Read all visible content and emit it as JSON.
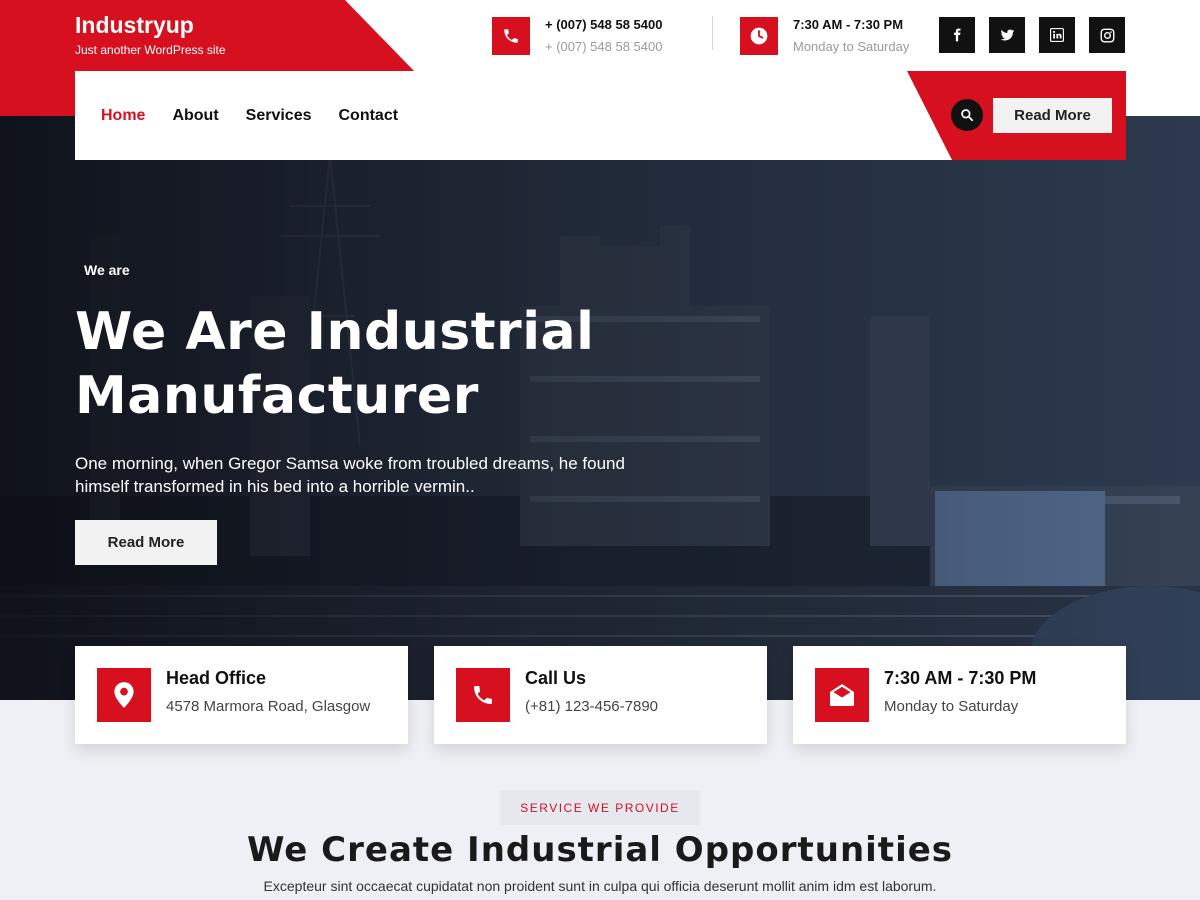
{
  "brand": {
    "name": "Industryup",
    "tagline": "Just another WordPress site"
  },
  "top_contact": {
    "phone": {
      "main": "+ (007) 548 58 5400",
      "sub": "+ (007) 548 58 5400",
      "icon": "phone-icon"
    },
    "hours": {
      "main": "7:30 AM - 7:30 PM",
      "sub": "Monday to Saturday",
      "icon": "clock-icon"
    }
  },
  "socials": [
    {
      "name": "facebook",
      "glyph": "f"
    },
    {
      "name": "twitter",
      "glyph": "t"
    },
    {
      "name": "linkedin",
      "glyph": "in"
    },
    {
      "name": "instagram",
      "glyph": "ig"
    }
  ],
  "nav": {
    "items": [
      {
        "label": "Home",
        "active": true
      },
      {
        "label": "About",
        "active": false
      },
      {
        "label": "Services",
        "active": false
      },
      {
        "label": "Contact",
        "active": false
      }
    ],
    "cta_label": "Read More"
  },
  "hero": {
    "eyebrow": "We are",
    "title_line1": "We Are Industrial",
    "title_line2": "Manufacturer",
    "text": "One morning, when Gregor Samsa woke from troubled dreams, he found himself transformed in his bed into a horrible vermin..",
    "button_label": "Read More"
  },
  "cards": [
    {
      "title": "Head Office",
      "text": "4578 Marmora Road, Glasgow",
      "icon": "map-pin-icon"
    },
    {
      "title": "Call Us",
      "text": "(+81) 123-456-7890",
      "icon": "phone-icon"
    },
    {
      "title": "7:30 AM - 7:30 PM",
      "text": "Monday to Saturday",
      "icon": "envelope-open-icon"
    }
  ],
  "services": {
    "tag": "SERVICE WE PROVIDE",
    "title": "We Create Industrial Opportunities",
    "description": "Excepteur sint occaecat cupidatat non proident sunt in culpa qui officia deserunt mollit anim idm est laborum."
  },
  "colors": {
    "accent": "#d7101f",
    "dark": "#111111",
    "light_bg": "#eef0f5"
  }
}
